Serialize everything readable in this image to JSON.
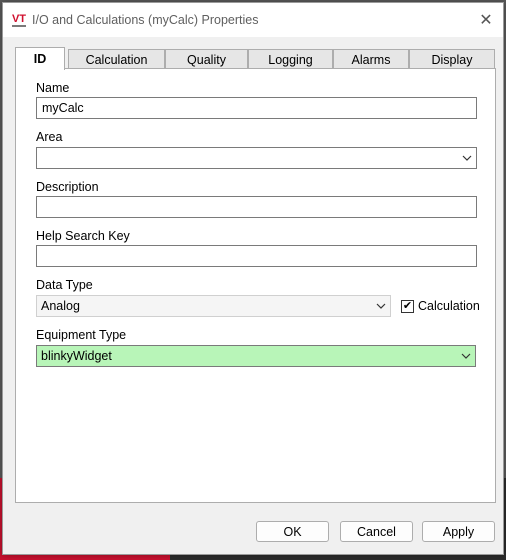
{
  "window": {
    "logo_text": "VT",
    "title": "I/O and Calculations (myCalc) Properties",
    "close_glyph": "✕"
  },
  "tabs": [
    {
      "label": "ID",
      "active": true
    },
    {
      "label": "Calculation",
      "active": false
    },
    {
      "label": "Quality",
      "active": false
    },
    {
      "label": "Logging",
      "active": false
    },
    {
      "label": "Alarms",
      "active": false
    },
    {
      "label": "Display",
      "active": false
    }
  ],
  "form": {
    "name": {
      "label": "Name",
      "value": "myCalc"
    },
    "area": {
      "label": "Area",
      "value": ""
    },
    "description": {
      "label": "Description",
      "value": ""
    },
    "help_search_key": {
      "label": "Help Search Key",
      "value": ""
    },
    "data_type": {
      "label": "Data Type",
      "value": "Analog"
    },
    "calculation_checkbox": {
      "label": "Calculation",
      "checked": true,
      "glyph": "✔"
    },
    "equipment_type": {
      "label": "Equipment Type",
      "value": "blinkyWidget",
      "highlight_color": "#b8f5b8"
    }
  },
  "buttons": {
    "ok": "OK",
    "cancel": "Cancel",
    "apply": "Apply"
  },
  "icons": {
    "dropdown": "chevron-down-icon"
  },
  "colors": {
    "logo_red": "#d0102e",
    "panel_bg": "#ffffff",
    "dialog_bg": "#f0f0f0"
  }
}
